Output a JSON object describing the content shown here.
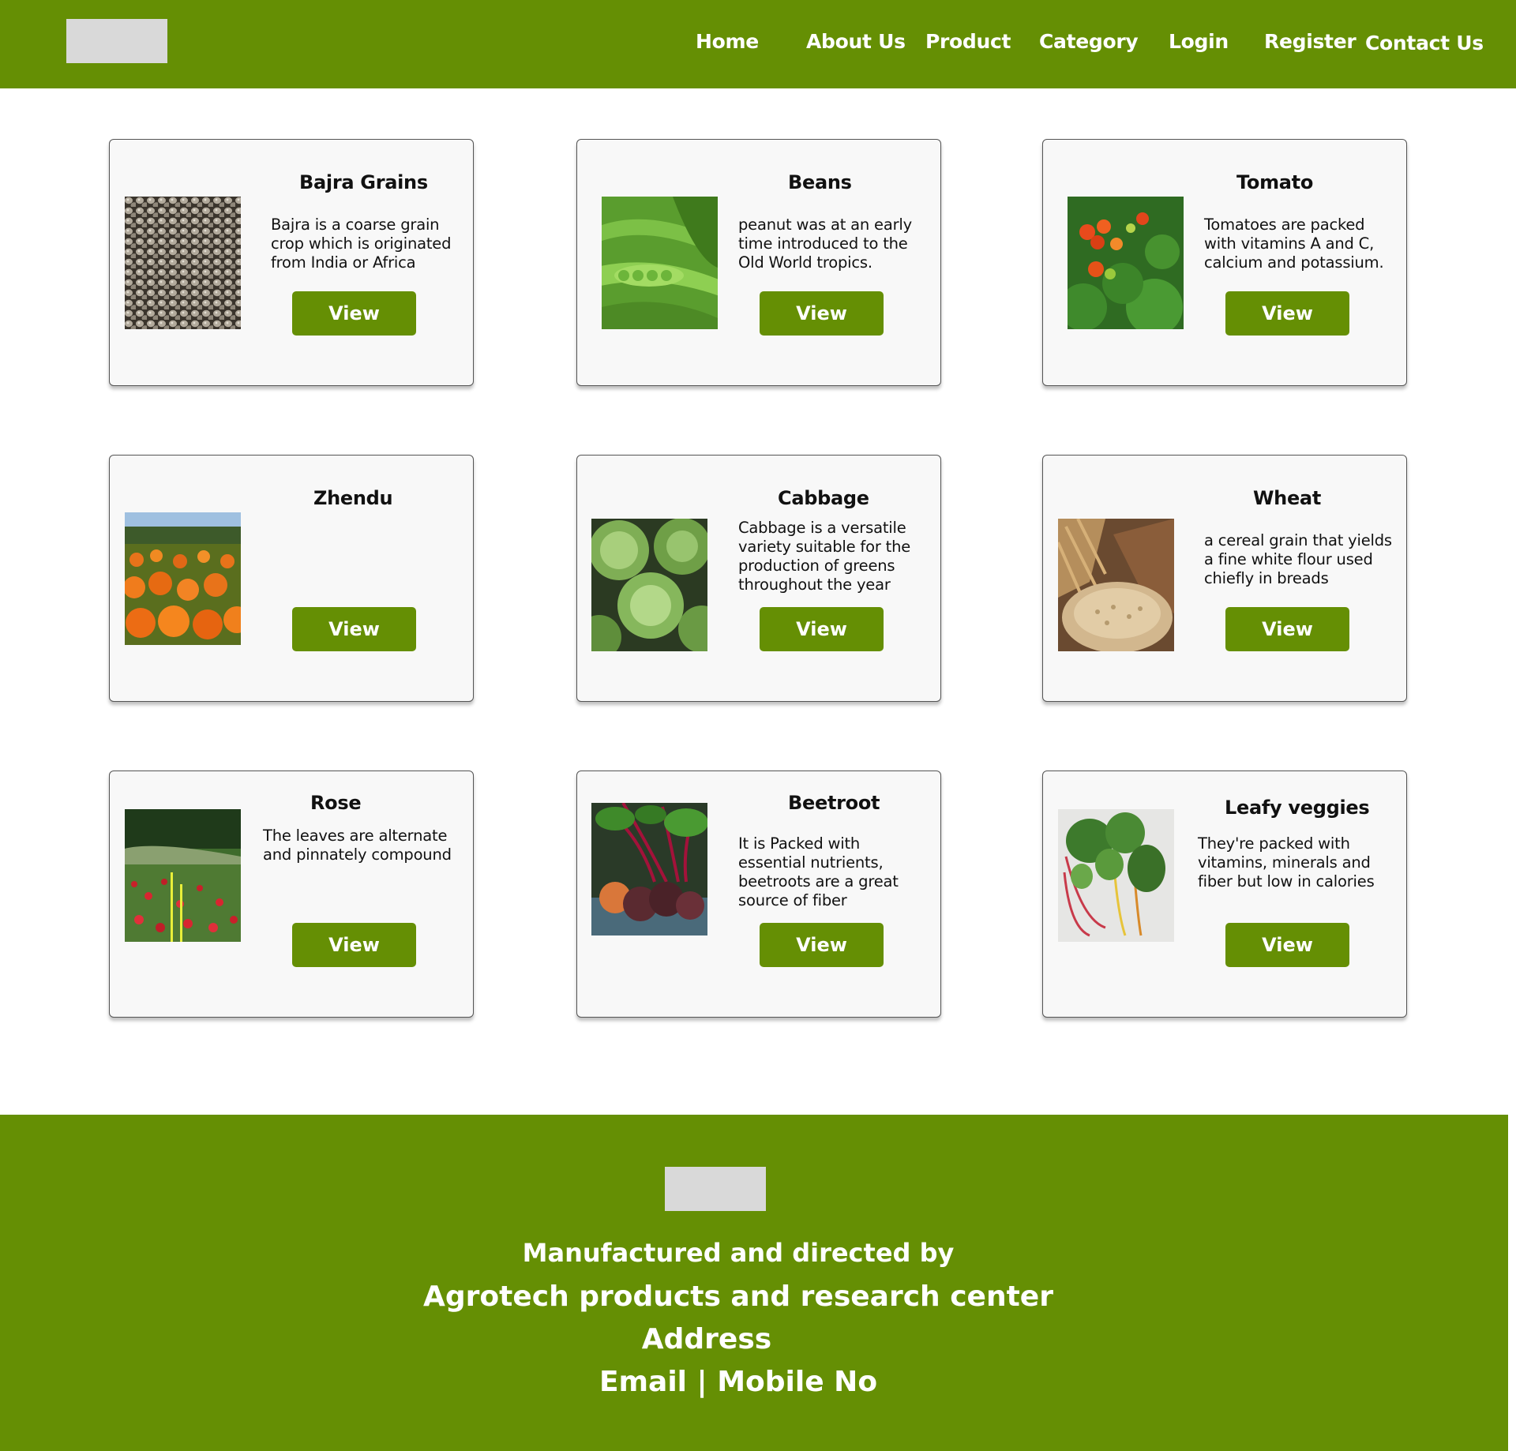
{
  "nav": {
    "items": [
      "Home",
      "About Us",
      "Product",
      "Category",
      "Login",
      "Register",
      "Contact Us"
    ]
  },
  "products": [
    {
      "title": "Bajra Grains",
      "description": "Bajra is a coarse grain crop which is originated from India or Africa",
      "button": "View",
      "image": "millet-grains-photo"
    },
    {
      "title": "Beans",
      "description": "peanut was at an early time introduced to the Old World tropics.",
      "button": "View",
      "image": "green-pea-pods-photo"
    },
    {
      "title": "Tomato",
      "description": "Tomatoes are packed with vitamins A and C, calcium and potassium.",
      "button": "View",
      "image": "tomato-plant-photo"
    },
    {
      "title": "Zhendu",
      "description": "",
      "button": "View",
      "image": "marigold-field-photo"
    },
    {
      "title": "Cabbage",
      "description": "Cabbage is a versatile variety suitable for the production of greens throughout the year",
      "button": "View",
      "image": "brussels-sprouts-photo"
    },
    {
      "title": "Wheat",
      "description": "a cereal grain that yields a fine white flour used chiefly in breads",
      "button": "View",
      "image": "wheat-sack-photo"
    },
    {
      "title": "Rose",
      "description": "The leaves are alternate and pinnately compound",
      "button": "View",
      "image": "rose-field-photo"
    },
    {
      "title": "Beetroot",
      "description": "It is Packed with essential nutrients, beetroots are a great source of fiber",
      "button": "View",
      "image": "beetroot-bunch-photo"
    },
    {
      "title": "Leafy veggies",
      "description": "They're packed with vitamins, minerals and fiber but low in calories",
      "button": "View",
      "image": "swiss-chard-photo"
    }
  ],
  "footer": {
    "line1": "Manufactured and directed by",
    "line2": "Agrotech products and research center",
    "line3": "Address",
    "line4": "Email | Mobile No"
  },
  "colors": {
    "brand_green": "#658f04",
    "logo_placeholder": "#d9d9d9",
    "card_bg": "#f8f8f8"
  }
}
